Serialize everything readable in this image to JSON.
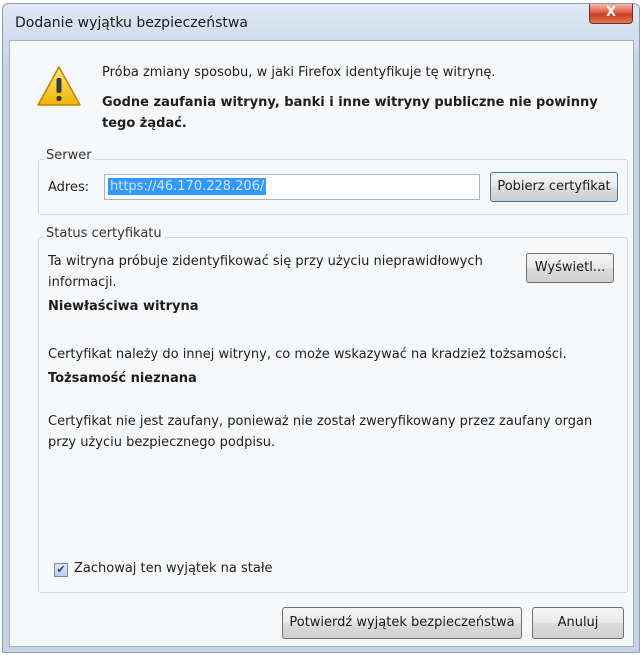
{
  "window": {
    "title": "Dodanie wyjątku bezpieczeństwa",
    "close_glyph": "X"
  },
  "warning": {
    "icon": "warning-triangle-icon",
    "line1": "Próba zmiany sposobu, w jaki Firefox identyfikuje tę witrynę.",
    "line2": "Godne zaufania witryny, banki i inne witryny publiczne nie powinny tego żądać."
  },
  "server": {
    "group_label": "Serwer",
    "address_label": "Adres:",
    "address_value": "https://46.170.228.206/",
    "fetch_button": "Pobierz certyfikat"
  },
  "status": {
    "group_label": "Status certyfikatu",
    "description": "Ta witryna próbuje zidentyfikować się przy użyciu nieprawidłowych informacji.",
    "view_button": "Wyświetl...",
    "wrong_site_title": "Niewłaściwa witryna",
    "wrong_site_text": "Certyfikat należy do innej witryny, co może wskazywać na kradzież tożsamości.",
    "unknown_identity_title": "Tożsamość nieznana",
    "unknown_identity_text": "Certyfikat nie jest zaufany, ponieważ nie został zweryfikowany przez zaufany organ przy użyciu bezpiecznego podpisu."
  },
  "permanent": {
    "label": "Zachowaj ten wyjątek na stałe",
    "checked": true
  },
  "buttons": {
    "confirm": "Potwierdź wyjątek bezpieczeństwa",
    "cancel": "Anuluj"
  },
  "colors": {
    "selection": "#3399ff",
    "warning": "#f5c400"
  }
}
